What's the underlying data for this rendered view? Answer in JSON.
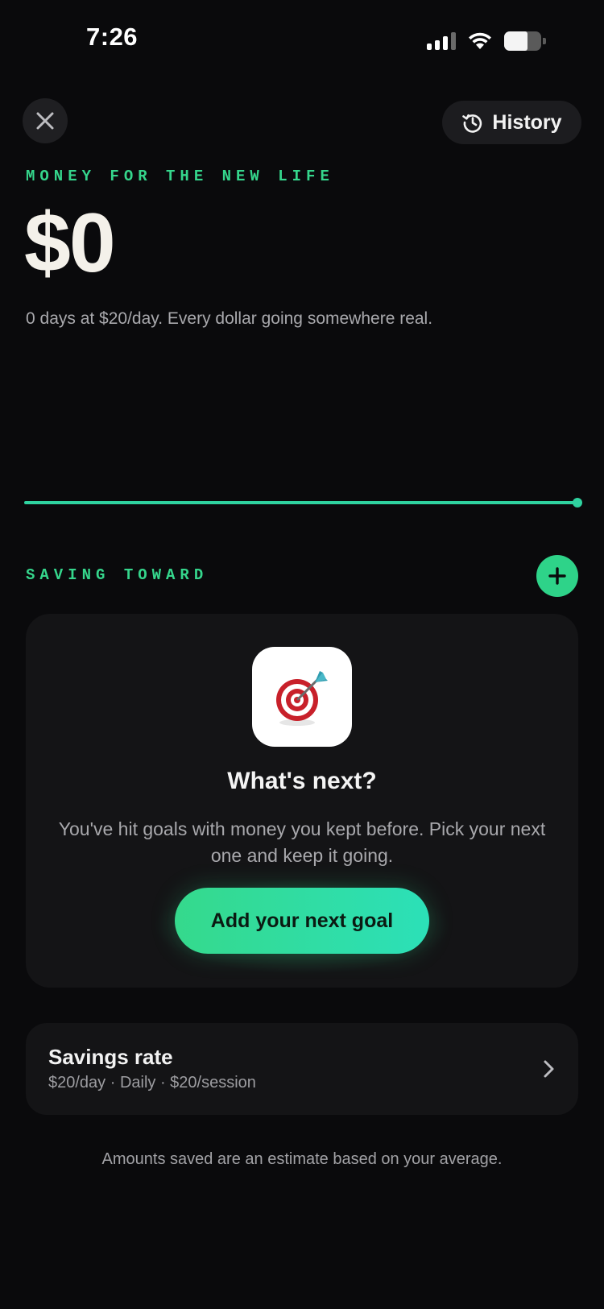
{
  "status_bar": {
    "time": "7:26"
  },
  "top_bar": {
    "history_label": "History"
  },
  "header": {
    "eyebrow": "MONEY FOR THE NEW LIFE",
    "amount": "$0",
    "subline": "0 days at $20/day. Every dollar going somewhere real."
  },
  "saving_toward": {
    "eyebrow": "SAVING TOWARD"
  },
  "goal_card": {
    "icon": "bullseye-dart-icon",
    "title": "What's next?",
    "body": "You've hit goals with money you kept before. Pick your next one and keep it going.",
    "cta_label": "Add your next goal"
  },
  "savings_rate": {
    "title": "Savings rate",
    "subtitle": "$20/day · Daily · $20/session"
  },
  "footnote": "Amounts saved are an estimate based on your average.",
  "colors": {
    "background": "#0a0a0c",
    "accent": "#2ed389",
    "card": "#141416",
    "amount": "#f4f1ea"
  }
}
